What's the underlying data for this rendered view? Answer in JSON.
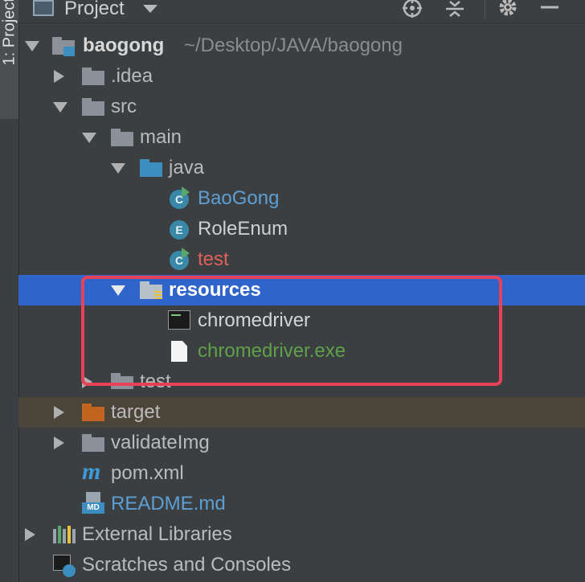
{
  "sidebar": {
    "tab_label": "1: Project"
  },
  "header": {
    "title": "Project"
  },
  "tree": [
    {
      "label": "baogong",
      "path": "~/Desktop/JAVA/baogong"
    },
    {
      "label": ".idea"
    },
    {
      "label": "src"
    },
    {
      "label": "main"
    },
    {
      "label": "java"
    },
    {
      "label": "BaoGong",
      "icon_letter": "C"
    },
    {
      "label": "RoleEnum",
      "icon_letter": "E"
    },
    {
      "label": "test",
      "icon_letter": "C"
    },
    {
      "label": "resources"
    },
    {
      "label": "chromedriver"
    },
    {
      "label": "chromedriver.exe"
    },
    {
      "label": "test"
    },
    {
      "label": "target"
    },
    {
      "label": "validateImg"
    },
    {
      "label": "pom.xml"
    },
    {
      "label": "README.md",
      "icon_text": "MD"
    },
    {
      "label": "External Libraries"
    },
    {
      "label": "Scratches and Consoles"
    }
  ],
  "colors": {
    "selection": "#2f65ca",
    "excluded_background": "#4a4538",
    "annotation_border": "#e94157",
    "run_class_text": "#5e9fd3",
    "error_text": "#e0605a",
    "untracked_text": "#5fa14a",
    "modified_text": "#5e9fd3"
  }
}
